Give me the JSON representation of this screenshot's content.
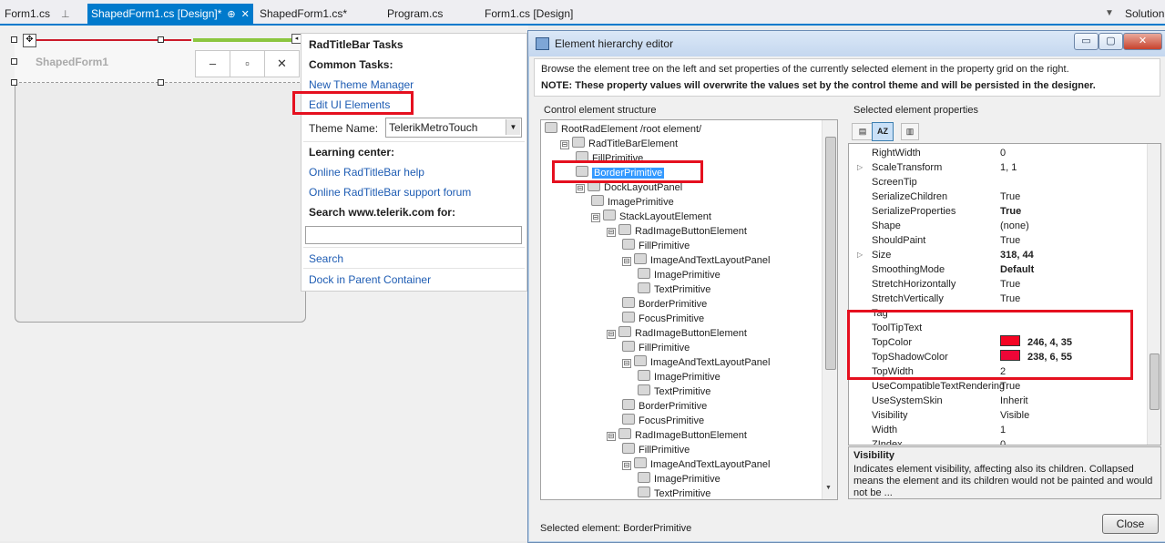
{
  "tabs": [
    {
      "label": "Form1.cs",
      "pin": "⊥"
    },
    {
      "label": "ShapedForm1.cs [Design]*",
      "pin": "⊕",
      "close": "✕"
    },
    {
      "label": "ShapedForm1.cs*"
    },
    {
      "label": "Program.cs"
    },
    {
      "label": "Form1.cs [Design]"
    }
  ],
  "tab_overflow": "▼",
  "solution_label": "Solution",
  "form": {
    "title": "ShapedForm1",
    "minimize": "‒",
    "maximize": "▫",
    "close": "✕"
  },
  "tasks": {
    "header": "RadTitleBar Tasks",
    "common_tasks": "Common Tasks:",
    "new_theme_manager": "New Theme Manager",
    "edit_ui_elements": "Edit UI Elements",
    "theme_name_label": "Theme Name:",
    "theme_name_value": "TelerikMetroTouch",
    "learning_center": "Learning center:",
    "help_link": "Online RadTitleBar help",
    "forum_link": "Online RadTitleBar support forum",
    "search_label": "Search www.telerik.com for:",
    "search_value": "",
    "search_link": "Search",
    "dock_link": "Dock in Parent Container"
  },
  "dialog": {
    "title": "Element hierarchy editor",
    "minimize": "▭",
    "maximize": "▢",
    "close": "✕",
    "description": "Browse the element tree on the left and set properties of the currently selected element in the property grid on the right.",
    "note": "NOTE: These property values will overwrite the values set by the control theme and will be persisted in the designer.",
    "tree_group": "Control element structure",
    "props_group": "Selected element properties",
    "tree": [
      {
        "label": "RootRadElement /root element/",
        "level": 0,
        "exp": ""
      },
      {
        "label": "RadTitleBarElement",
        "level": 1,
        "exp": "⊟"
      },
      {
        "label": "FillPrimitive",
        "level": 2,
        "exp": ""
      },
      {
        "label": "BorderPrimitive",
        "level": 2,
        "exp": "",
        "selected": true
      },
      {
        "label": "DockLayoutPanel",
        "level": 2,
        "exp": "⊟"
      },
      {
        "label": "ImagePrimitive",
        "level": 3,
        "exp": ""
      },
      {
        "label": "StackLayoutElement",
        "level": 3,
        "exp": "⊟"
      },
      {
        "label": "RadImageButtonElement",
        "level": 4,
        "exp": "⊟"
      },
      {
        "label": "FillPrimitive",
        "level": 5,
        "exp": ""
      },
      {
        "label": "ImageAndTextLayoutPanel",
        "level": 5,
        "exp": "⊟"
      },
      {
        "label": "ImagePrimitive",
        "level": 6,
        "exp": ""
      },
      {
        "label": "TextPrimitive",
        "level": 6,
        "exp": ""
      },
      {
        "label": "BorderPrimitive",
        "level": 5,
        "exp": ""
      },
      {
        "label": "FocusPrimitive",
        "level": 5,
        "exp": ""
      },
      {
        "label": "RadImageButtonElement",
        "level": 4,
        "exp": "⊟"
      },
      {
        "label": "FillPrimitive",
        "level": 5,
        "exp": ""
      },
      {
        "label": "ImageAndTextLayoutPanel",
        "level": 5,
        "exp": "⊟"
      },
      {
        "label": "ImagePrimitive",
        "level": 6,
        "exp": ""
      },
      {
        "label": "TextPrimitive",
        "level": 6,
        "exp": ""
      },
      {
        "label": "BorderPrimitive",
        "level": 5,
        "exp": ""
      },
      {
        "label": "FocusPrimitive",
        "level": 5,
        "exp": ""
      },
      {
        "label": "RadImageButtonElement",
        "level": 4,
        "exp": "⊟"
      },
      {
        "label": "FillPrimitive",
        "level": 5,
        "exp": ""
      },
      {
        "label": "ImageAndTextLayoutPanel",
        "level": 5,
        "exp": "⊟"
      },
      {
        "label": "ImagePrimitive",
        "level": 6,
        "exp": ""
      },
      {
        "label": "TextPrimitive",
        "level": 6,
        "exp": ""
      }
    ],
    "properties": [
      {
        "name": "RightWidth",
        "value": "0"
      },
      {
        "name": "ScaleTransform",
        "value": "1, 1",
        "expand": "▷"
      },
      {
        "name": "ScreenTip",
        "value": ""
      },
      {
        "name": "SerializeChildren",
        "value": "True"
      },
      {
        "name": "SerializeProperties",
        "value": "True",
        "bold": true
      },
      {
        "name": "Shape",
        "value": "(none)"
      },
      {
        "name": "ShouldPaint",
        "value": "True"
      },
      {
        "name": "Size",
        "value": "318, 44",
        "bold": true,
        "expand": "▷"
      },
      {
        "name": "SmoothingMode",
        "value": "Default",
        "bold": true
      },
      {
        "name": "StretchHorizontally",
        "value": "True"
      },
      {
        "name": "StretchVertically",
        "value": "True"
      },
      {
        "name": "Tag",
        "value": ""
      },
      {
        "name": "ToolTipText",
        "value": ""
      },
      {
        "name": "TopColor",
        "value": "246, 4, 35",
        "bold": true,
        "color": "#f60423"
      },
      {
        "name": "TopShadowColor",
        "value": "238, 6, 55",
        "bold": true,
        "color": "#ee0637"
      },
      {
        "name": "TopWidth",
        "value": "2"
      },
      {
        "name": "UseCompatibleTextRendering",
        "value": "True"
      },
      {
        "name": "UseSystemSkin",
        "value": "Inherit"
      },
      {
        "name": "Visibility",
        "value": "Visible"
      },
      {
        "name": "Width",
        "value": "1"
      },
      {
        "name": "ZIndex",
        "value": "0"
      }
    ],
    "desc_title": "Visibility",
    "desc_text": "Indicates element visibility, affecting also its children. Collapsed means the element and its children would not be painted and would not be ...",
    "status": "Selected element: BorderPrimitive",
    "close_button": "Close"
  },
  "colors": {
    "accent": "#007acc",
    "highlight": "#e5101f",
    "selection": "#3399ff"
  }
}
